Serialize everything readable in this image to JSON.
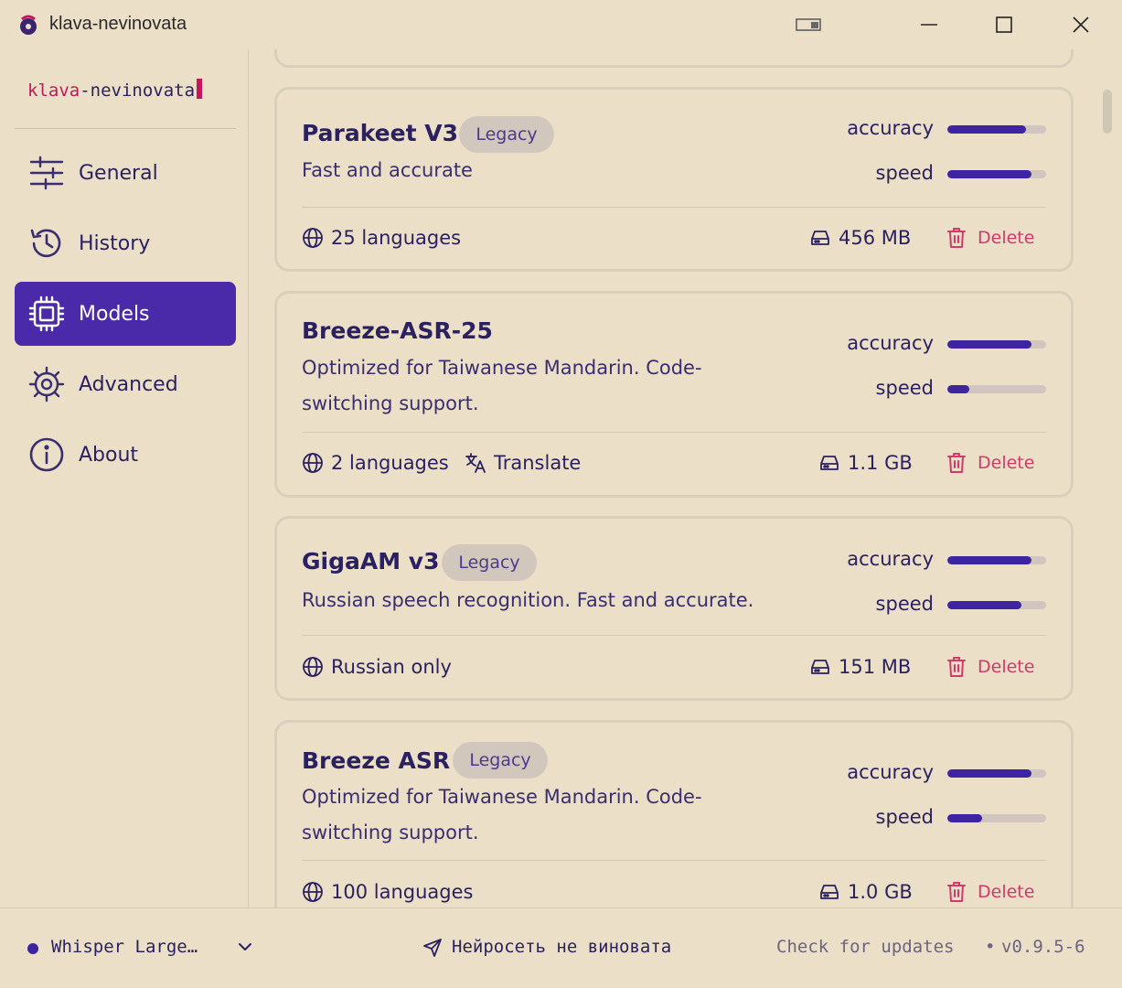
{
  "window": {
    "title": "klava-nevinovata",
    "icons": [
      "app-icon",
      "overlay-icon",
      "minimize-icon",
      "maximize-icon",
      "close-icon"
    ]
  },
  "sidebar": {
    "brand_part1": "klava",
    "brand_part2": "-nevinovata",
    "items": [
      {
        "label": "General",
        "icon": "sliders-icon",
        "active": false
      },
      {
        "label": "History",
        "icon": "history-icon",
        "active": false
      },
      {
        "label": "Models",
        "icon": "cpu-icon",
        "active": true
      },
      {
        "label": "Advanced",
        "icon": "gear-icon",
        "active": false
      },
      {
        "label": "About",
        "icon": "info-icon",
        "active": false
      }
    ]
  },
  "models": [
    {
      "name": "Parakeet V3",
      "badge": "Legacy",
      "description": "Fast and accurate",
      "accuracy_label": "accuracy",
      "speed_label": "speed",
      "accuracy": 0.8,
      "speed": 0.85,
      "languages": "25 languages",
      "translate": "",
      "size": "456 MB",
      "delete_label": "Delete"
    },
    {
      "name": "Breeze-ASR-25",
      "badge": "",
      "description": "Optimized for Taiwanese Mandarin. Code-switching support.",
      "accuracy_label": "accuracy",
      "speed_label": "speed",
      "accuracy": 0.85,
      "speed": 0.22,
      "languages": "2 languages",
      "translate": "Translate",
      "size": "1.1 GB",
      "delete_label": "Delete"
    },
    {
      "name": "GigaAM v3",
      "badge": "Legacy",
      "description": "Russian speech recognition. Fast and accurate.",
      "accuracy_label": "accuracy",
      "speed_label": "speed",
      "accuracy": 0.85,
      "speed": 0.75,
      "languages": "Russian only",
      "translate": "",
      "size": "151 MB",
      "delete_label": "Delete"
    },
    {
      "name": "Breeze ASR",
      "badge": "Legacy",
      "description": "Optimized for Taiwanese Mandarin. Code-switching support.",
      "accuracy_label": "accuracy",
      "speed_label": "speed",
      "accuracy": 0.85,
      "speed": 0.35,
      "languages": "100 languages",
      "translate": "",
      "size": "1.0 GB",
      "delete_label": "Delete"
    }
  ],
  "footer": {
    "current_model": "Whisper Large…",
    "tagline": "Нейросеть не виновата",
    "check_updates": "Check for updates",
    "separator": "•",
    "version": "v0.9.5-6"
  },
  "colors": {
    "background": "#ebe0c7",
    "accent": "#4a2aa8",
    "bar_fill": "#3d24a0",
    "danger": "#d23a6a",
    "brand_pink": "#c2185b"
  }
}
